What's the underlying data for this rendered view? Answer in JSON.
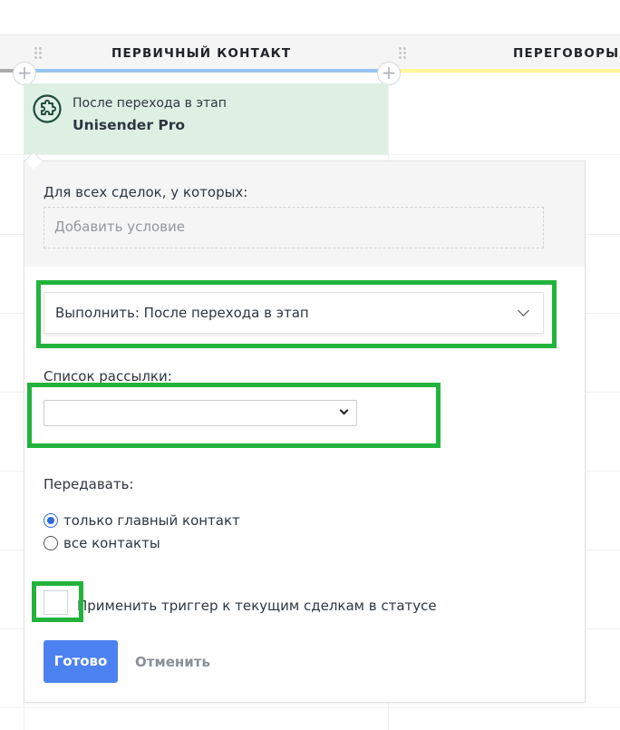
{
  "board": {
    "columns": [
      {
        "title": "ПЕРВИЧНЫЙ КОНТАКТ",
        "bar_color": "#99c5f5"
      },
      {
        "title": "ПЕРЕГОВОРЫ",
        "bar_color": "#fff79a"
      }
    ],
    "add_symbol": "+"
  },
  "trigger": {
    "subtitle": "После перехода в этап",
    "name": "Unisender Pro",
    "icon": "puzzle-icon"
  },
  "popup": {
    "condition_label": "Для всех сделок, у которых:",
    "condition_placeholder": "Добавить условие",
    "execute_value": "Выполнить: После перехода в этап",
    "mailing_list_label": "Список рассылки:",
    "mailing_list_value": "",
    "transfer_label": "Передавать:",
    "transfer_options": [
      {
        "label": "только главный контакт",
        "checked": true
      },
      {
        "label": "все контакты",
        "checked": false
      }
    ],
    "apply_checkbox_label": "Применить триггер к текущим сделкам в статусе",
    "apply_checked": false,
    "done_label": "Готово",
    "cancel_label": "Отменить"
  },
  "colors": {
    "highlight": "#22b33c",
    "primary_button": "#4c82f0",
    "trigger_card_bg": "#def0e4"
  }
}
